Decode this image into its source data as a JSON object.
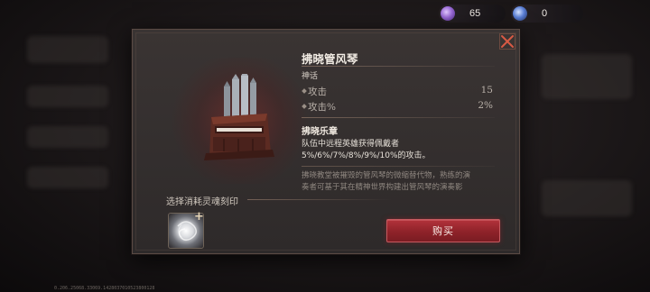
{
  "resources": [
    {
      "name": "soul-crystal",
      "value": "65",
      "color": "#9a6ad6"
    },
    {
      "name": "blue-gem",
      "value": "0",
      "color": "#5a7fd6"
    }
  ],
  "item": {
    "name": "拂晓管风琴",
    "rarity": "神话",
    "icon": "pipe-organ-icon",
    "stats": [
      {
        "label": "攻击",
        "value": "15"
      },
      {
        "label": "攻击%",
        "value": "2%"
      }
    ],
    "skill": {
      "name": "拂晓乐章",
      "description_lines": [
        "队伍中远程英雄获得佩戴者",
        "5%/6%/7%/8%/9%/10%的攻击。"
      ]
    },
    "lore_lines": [
      "拂晓教堂被摧毁的管风琴的微缩替代物，熟练的演",
      "奏者可基于其在精神世界构建出管风琴的演奏影"
    ]
  },
  "engraving": {
    "label": "选择消耗灵魂刻印",
    "slot_icon": "soul-imprint-icon",
    "add_symbol": "+"
  },
  "actions": {
    "buy_label": "购买",
    "close_icon": "close-x-icon"
  },
  "footer_text": "0.206.25068.33069.1428037010523800128",
  "colors": {
    "buy_button": "#9e2a31",
    "panel": "#332e2e",
    "accent_close": "#c94a3a"
  }
}
